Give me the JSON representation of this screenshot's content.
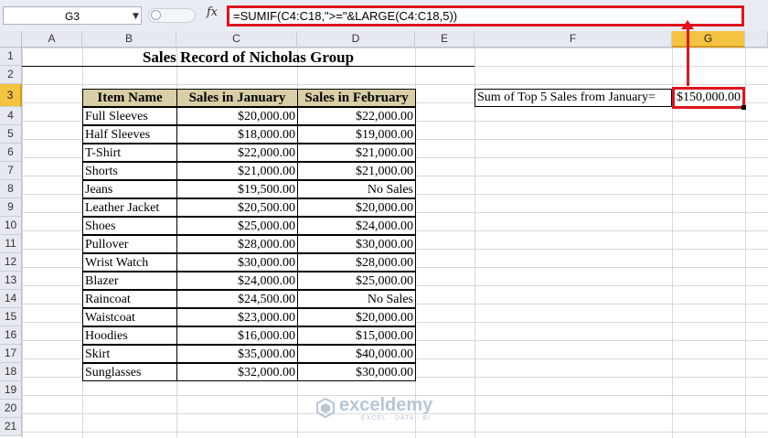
{
  "formula_bar": {
    "name_box": "G3",
    "fx_label": "fx",
    "formula": "=SUMIF(C4:C18,\">=\"&LARGE(C4:C18,5))"
  },
  "columns": [
    "A",
    "B",
    "C",
    "D",
    "E",
    "F",
    "G"
  ],
  "rows": [
    "1",
    "2",
    "3",
    "4",
    "5",
    "6",
    "7",
    "8",
    "9",
    "10",
    "11",
    "12",
    "13",
    "14",
    "15",
    "16",
    "17",
    "18",
    "19",
    "20",
    "21"
  ],
  "selected_cell": {
    "column": "G",
    "row": "3"
  },
  "sheet": {
    "title": "Sales Record of Nicholas Group",
    "headers": [
      "Item Name",
      "Sales in January",
      "Sales in February"
    ],
    "items": [
      {
        "name": "Full Sleeves",
        "jan": "$20,000.00",
        "feb": "$22,000.00"
      },
      {
        "name": "Half Sleeves",
        "jan": "$18,000.00",
        "feb": "$19,000.00"
      },
      {
        "name": "T-Shirt",
        "jan": "$22,000.00",
        "feb": "$21,000.00"
      },
      {
        "name": "Shorts",
        "jan": "$21,000.00",
        "feb": "$21,000.00"
      },
      {
        "name": "Jeans",
        "jan": "$19,500.00",
        "feb": "No Sales"
      },
      {
        "name": "Leather Jacket",
        "jan": "$20,500.00",
        "feb": "$20,000.00"
      },
      {
        "name": "Shoes",
        "jan": "$25,000.00",
        "feb": "$24,000.00"
      },
      {
        "name": "Pullover",
        "jan": "$28,000.00",
        "feb": "$30,000.00"
      },
      {
        "name": "Wrist Watch",
        "jan": "$30,000.00",
        "feb": "$28,000.00"
      },
      {
        "name": "Blazer",
        "jan": "$24,000.00",
        "feb": "$25,000.00"
      },
      {
        "name": "Raincoat",
        "jan": "$24,500.00",
        "feb": "No Sales"
      },
      {
        "name": "Waistcoat",
        "jan": "$23,000.00",
        "feb": "$20,000.00"
      },
      {
        "name": "Hoodies",
        "jan": "$16,000.00",
        "feb": "$15,000.00"
      },
      {
        "name": "Skirt",
        "jan": "$35,000.00",
        "feb": "$40,000.00"
      },
      {
        "name": "Sunglasses",
        "jan": "$32,000.00",
        "feb": "$30,000.00"
      }
    ],
    "sum_label": "Sum of Top 5 Sales from January=",
    "sum_value": "$150,000.00"
  },
  "watermark": {
    "name": "exceldemy",
    "tagline": "EXCEL · DATA · BI"
  },
  "colors": {
    "highlight": "#e0141e",
    "header_fill": "#d9cfa6",
    "selected_header": "#f5c342"
  }
}
